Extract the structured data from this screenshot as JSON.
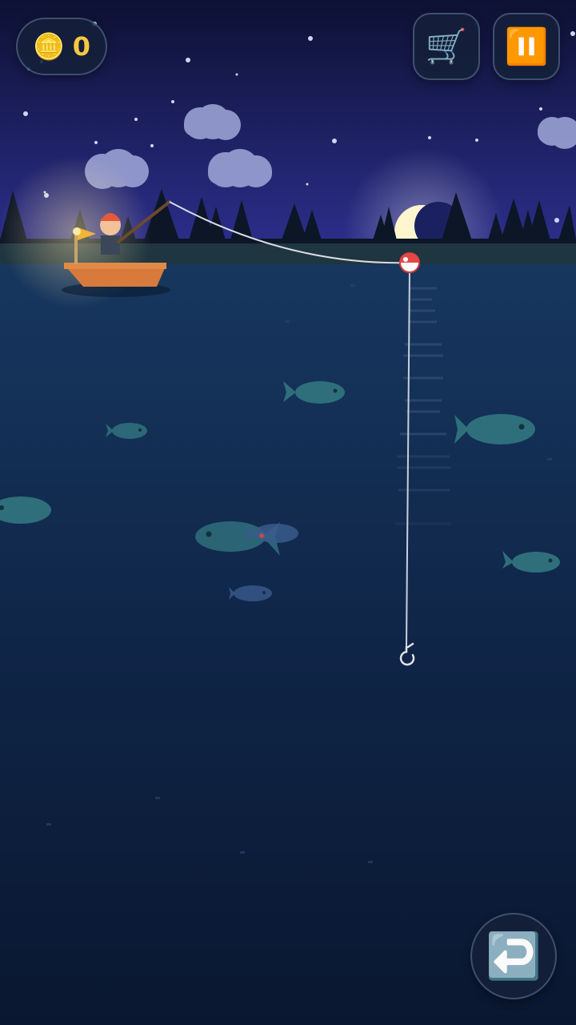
{
  "hud": {
    "coins": "0",
    "coin_icon": "coin-icon",
    "shop_icon": "🛒",
    "pause_icon": "⏸️",
    "back_icon": "↩️"
  },
  "colors": {
    "sky_top": "#0e1230",
    "sky_bottom": "#2a2f8a",
    "water_top": "#16365f",
    "water_bottom": "#0b1a33",
    "moon": "#fff6cf",
    "boat": "#d77a3b",
    "hat": "#e35a3c",
    "fish_teal": "#2f6f7c",
    "fish_blue": "#3a5a8c"
  },
  "scene": {
    "fish": [
      {
        "kind": "teal",
        "facing": "right"
      },
      {
        "kind": "teal",
        "facing": "right"
      },
      {
        "kind": "teal",
        "facing": "right"
      },
      {
        "kind": "teal",
        "facing": "left"
      },
      {
        "kind": "teal",
        "facing": "left"
      },
      {
        "kind": "blue",
        "facing": "right"
      },
      {
        "kind": "blue",
        "facing": "right"
      },
      {
        "kind": "teal",
        "facing": "right"
      }
    ]
  }
}
